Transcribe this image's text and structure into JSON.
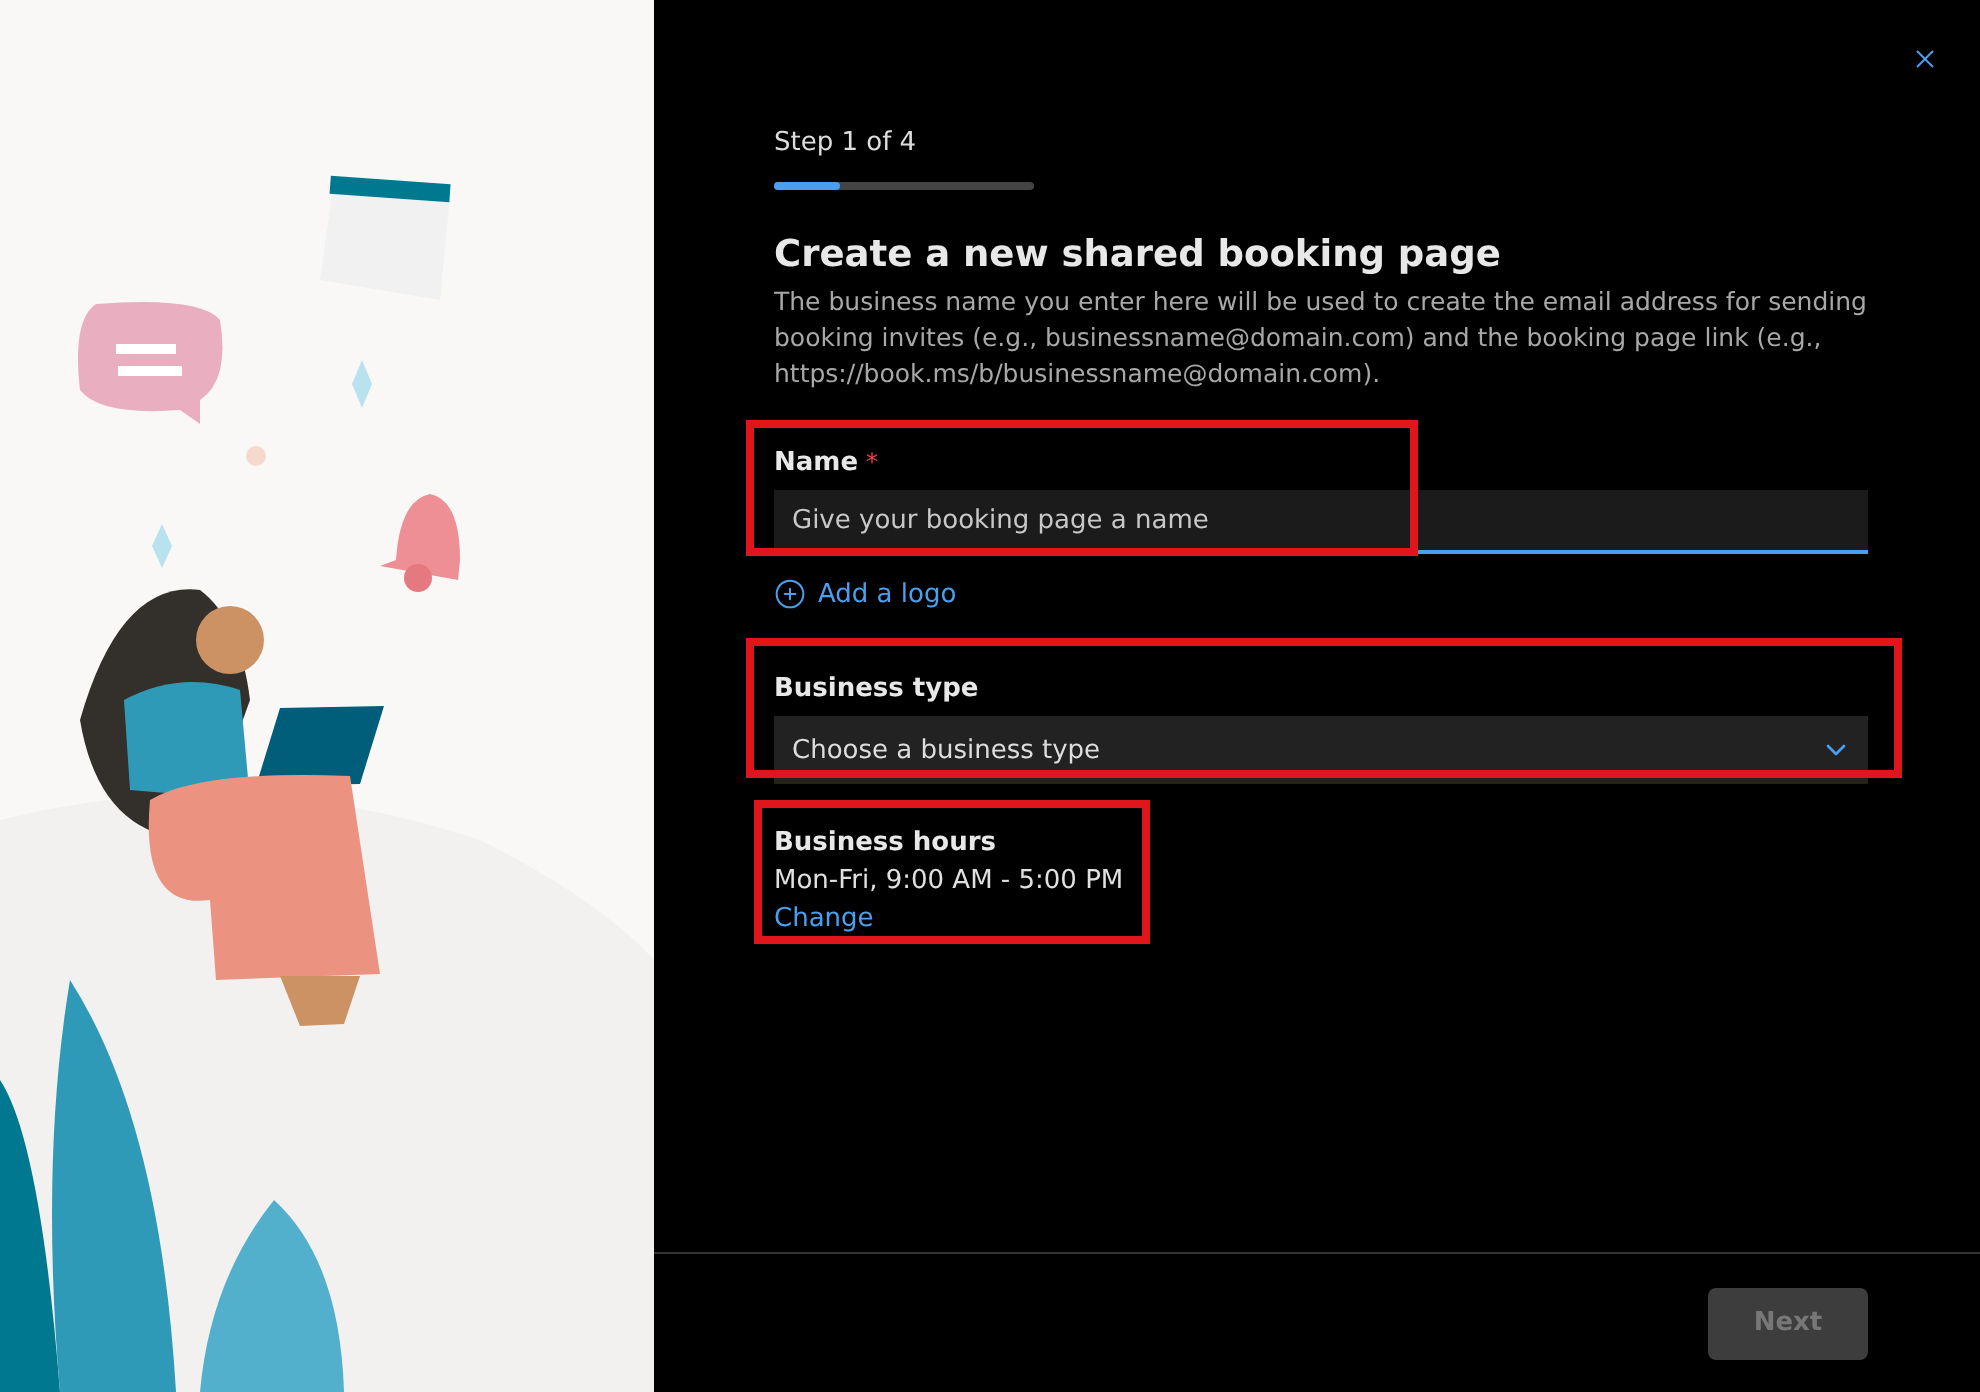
{
  "step": {
    "label": "Step 1 of 4",
    "level": 0.25
  },
  "title": "Create a new shared booking page",
  "description": "The business name you enter here will be used to create the email address for sending booking invites (e.g., businessname@domain.com) and the booking page link (e.g., https://book.ms/b/businessname@domain.com).",
  "name_field": {
    "label": "Name",
    "required_mark": "*",
    "placeholder": "Give your booking page a name",
    "focused": true,
    "highlighted": true
  },
  "add_logo": "Add a logo",
  "business_type": {
    "label": "Business type",
    "value": "Choose a business type",
    "highlighted": true
  },
  "business_hours": {
    "label": "Business hours",
    "value": "Mon-Fri, 9:00 AM - 5:00 PM",
    "link": "Change",
    "highlighted": true
  },
  "next_button": {
    "label": "Next",
    "disabled": true
  }
}
